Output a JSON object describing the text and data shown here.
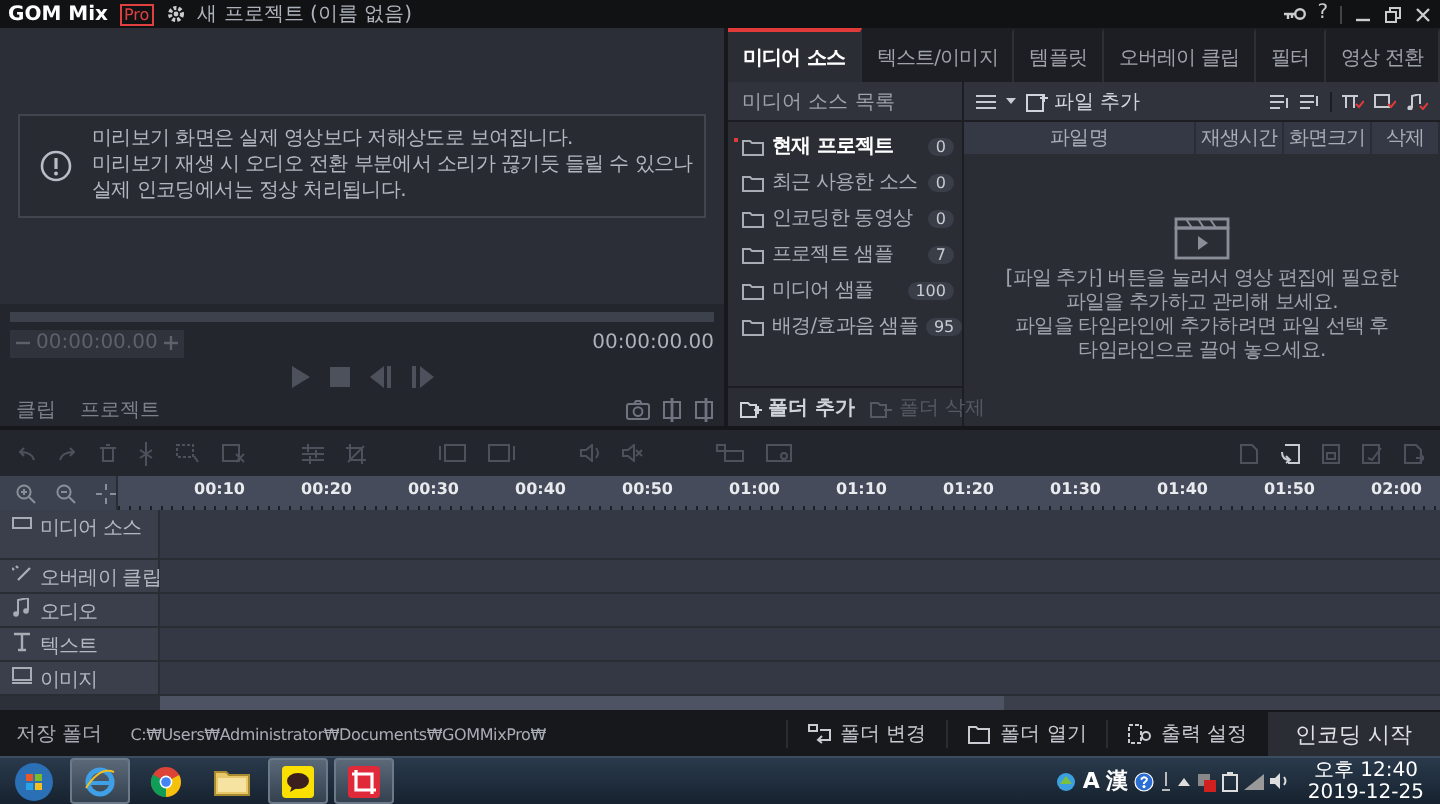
{
  "title_bar": {
    "logo": "GOM Mix",
    "badge": "Pro",
    "title": "새 프로젝트 (이름 없음)",
    "help": "?"
  },
  "preview": {
    "notice": [
      "미리보기 화면은 실제 영상보다 저해상도로 보여집니다.",
      "미리보기 재생 시 오디오 전환 부분에서 소리가 끊기듯 들릴 수 있으나",
      "실제 인코딩에서는 정상 처리됩니다."
    ],
    "progress": {
      "level": 0
    },
    "time_field": "00:00:00.00",
    "timecode": "00:00:00.00",
    "tabs": [
      {
        "label": "클립",
        "selected": false
      },
      {
        "label": "프로젝트",
        "selected": false
      }
    ]
  },
  "media_panel": {
    "tabs": [
      {
        "label": "미디어 소스",
        "selected": true
      },
      {
        "label": "텍스트/이미지",
        "selected": false
      },
      {
        "label": "템플릿",
        "selected": false
      },
      {
        "label": "오버레이 클립",
        "selected": false
      },
      {
        "label": "필터",
        "selected": false
      },
      {
        "label": "영상 전환",
        "selected": false
      }
    ],
    "list_title": "미디어 소스 목록",
    "sources": [
      {
        "label": "현재 프로젝트",
        "count": "0",
        "selected": true
      },
      {
        "label": "최근 사용한 소스",
        "count": "0",
        "selected": false
      },
      {
        "label": "인코딩한 동영상",
        "count": "0",
        "selected": false
      },
      {
        "label": "프로젝트 샘플",
        "count": "7",
        "selected": false
      },
      {
        "label": "미디어 샘플",
        "count": "100",
        "selected": false
      },
      {
        "label": "배경/효과음 샘플",
        "count": "95",
        "selected": false
      }
    ],
    "folder_actions": [
      {
        "label": "폴더 추가",
        "disabled": false
      },
      {
        "label": "폴더 삭제",
        "disabled": true
      }
    ],
    "add_file": "파일 추가",
    "columns": [
      "파일명",
      "재생시간",
      "화면크기",
      "삭제"
    ],
    "empty_text": [
      "[파일 추가] 버튼을 눌러서 영상 편집에 필요한",
      "파일을 추가하고 관리해 보세요.",
      "파일을 타임라인에 추가하려면 파일 선택 후",
      "타임라인으로 끌어 놓으세요."
    ]
  },
  "timeline": {
    "ruler": [
      "00:10",
      "00:20",
      "00:30",
      "00:40",
      "00:50",
      "01:00",
      "01:10",
      "01:20",
      "01:30",
      "01:40",
      "01:50",
      "02:00"
    ],
    "tracks": [
      {
        "kind": "media",
        "label": "미디어 소스"
      },
      {
        "kind": "overlay",
        "label": "오버레이 클립"
      },
      {
        "kind": "audio",
        "label": "오디오"
      },
      {
        "kind": "text",
        "label": "텍스트"
      },
      {
        "kind": "image",
        "label": "이미지"
      }
    ]
  },
  "footer": {
    "save_label": "저장 폴더",
    "path": "C:₩Users₩Administrator₩Documents₩GOMMixPro₩",
    "buttons": [
      {
        "kind": "change",
        "label": "폴더 변경"
      },
      {
        "kind": "open",
        "label": "폴더 열기"
      },
      {
        "kind": "settings",
        "label": "출력 설정"
      },
      {
        "kind": "encode",
        "label": "인코딩 시작"
      }
    ]
  },
  "taskbar": {
    "ime": [
      "A",
      "漢"
    ],
    "time": "오후 12:40",
    "date": "2019-12-25"
  }
}
